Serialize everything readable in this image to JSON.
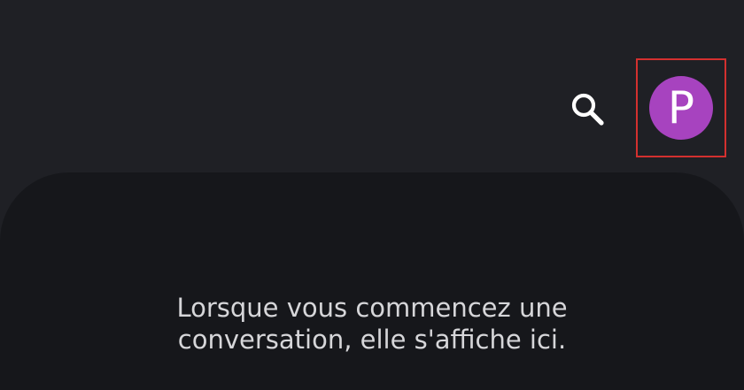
{
  "header": {
    "search_icon": "search-icon",
    "avatar_initial": "P",
    "avatar_color": "#a743bf",
    "highlight_color": "#d3302f"
  },
  "main": {
    "empty_message_line1": "Lorsque vous commencez une",
    "empty_message_line2": "conversation, elle s'affiche ici."
  }
}
